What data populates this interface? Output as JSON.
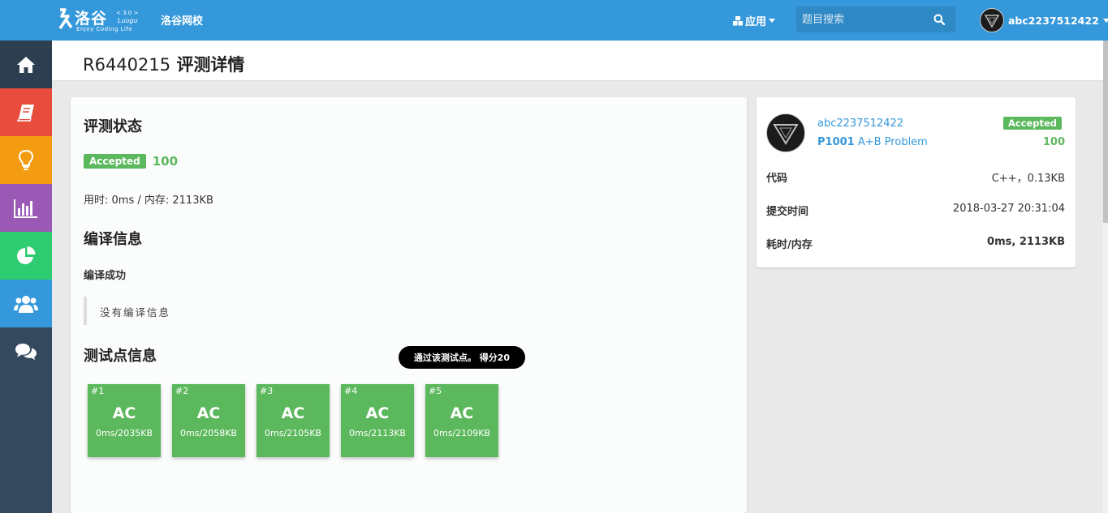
{
  "topbar": {
    "logo": {
      "name": "洛谷",
      "version": "< 3.0 >",
      "luogu": "Luogu",
      "tagline": "Enjoy Coding Life"
    },
    "nav_link": "洛谷网校",
    "apps_label": "应用",
    "search_placeholder": "题目搜索",
    "username": "abc2237512422"
  },
  "sidebar": {
    "items": [
      {
        "icon": "home-icon",
        "color": "#2c3e50"
      },
      {
        "icon": "book-icon",
        "color": "#e74c3c"
      },
      {
        "icon": "lightbulb-icon",
        "color": "#f39c12"
      },
      {
        "icon": "bar-chart-icon",
        "color": "#9b59b6"
      },
      {
        "icon": "pie-chart-icon",
        "color": "#2ecc71"
      },
      {
        "icon": "users-icon",
        "color": "#3498db"
      },
      {
        "icon": "comments-icon",
        "color": "#34495e"
      }
    ]
  },
  "header": {
    "record_id": "R6440215",
    "title": "评测详情"
  },
  "main": {
    "status_title": "评测状态",
    "status_badge": "Accepted",
    "score": "100",
    "time_mem": "用时: 0ms / 内存: 2113KB",
    "compile_title": "编译信息",
    "compile_result": "编译成功",
    "compile_message": "没有编译信息",
    "tests_title": "测试点信息",
    "tooltip": "通过该测试点。 得分20",
    "testcases": [
      {
        "index": "#1",
        "result": "AC",
        "meta": "0ms/2035KB"
      },
      {
        "index": "#2",
        "result": "AC",
        "meta": "0ms/2058KB"
      },
      {
        "index": "#3",
        "result": "AC",
        "meta": "0ms/2105KB"
      },
      {
        "index": "#4",
        "result": "AC",
        "meta": "0ms/2113KB"
      },
      {
        "index": "#5",
        "result": "AC",
        "meta": "0ms/2109KB"
      }
    ]
  },
  "side": {
    "username": "abc2237512422",
    "problem_id": "P1001",
    "problem_name": "A+B Problem",
    "status_badge": "Accepted",
    "score": "100",
    "rows": [
      {
        "key": "代码",
        "value": "C++，0.13KB"
      },
      {
        "key": "提交时间",
        "value": "2018-03-27 20:31:04"
      },
      {
        "key": "耗时/内存",
        "value": "0ms, 2113KB"
      }
    ]
  },
  "colors": {
    "brand": "#3498db",
    "accepted": "#5cb85c",
    "sidebar": "#34495e"
  }
}
